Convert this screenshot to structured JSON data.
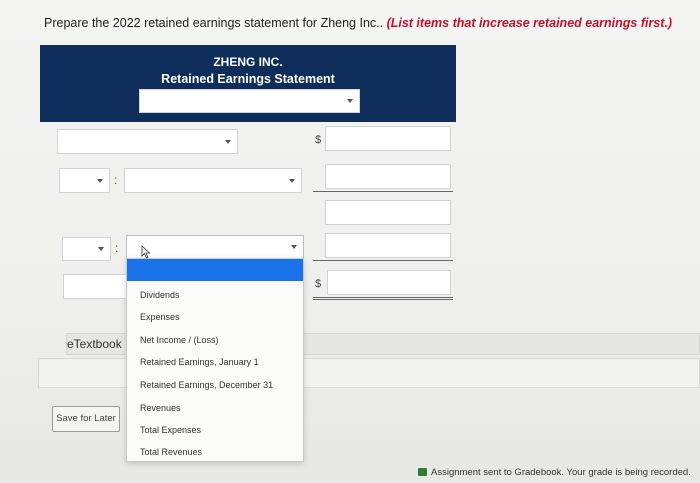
{
  "prompt": {
    "main": "Prepare the 2022 retained earnings statement for Zheng Inc.. ",
    "hint": "(List items that increase retained earnings first.)"
  },
  "statement": {
    "company": "ZHENG INC.",
    "title": "Retained Earnings Statement"
  },
  "currency_symbol": "$",
  "dropdown": {
    "options": [
      "Dividends",
      "Expenses",
      "Net Income / (Loss)",
      "Retained Earnings, January 1",
      "Retained Earnings, December 31",
      "Revenues",
      "Total Expenses",
      "Total Revenues"
    ]
  },
  "etextbook_label": "eTextbook",
  "save_button_label": "Save for Later",
  "status_message": "Assignment sent to Gradebook. Your grade is being recorded.",
  "colors": {
    "header_bg": "#0f2d5a",
    "hint_text": "#c8102e",
    "highlight": "#1a73e8"
  }
}
